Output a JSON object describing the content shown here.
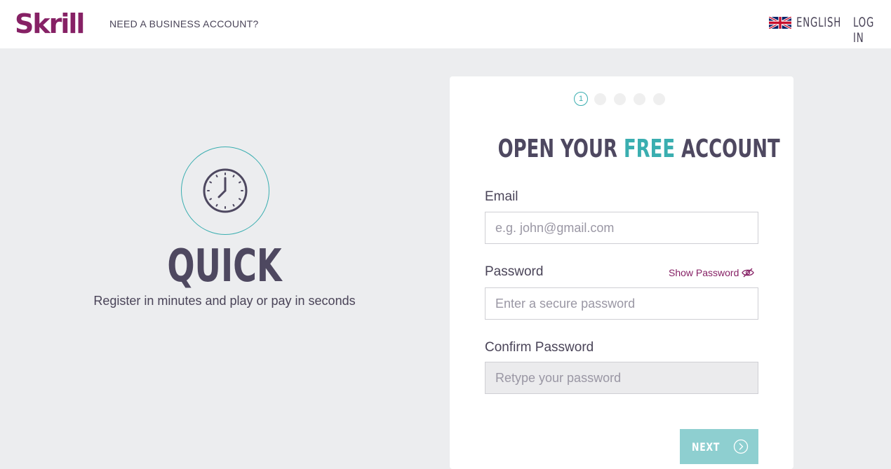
{
  "header": {
    "logo": "Skrill",
    "business_link": "NEED A BUSINESS ACCOUNT?",
    "language": "ENGLISH",
    "login": "LOG IN"
  },
  "promo": {
    "icon": "clock-icon",
    "title": "QUICK",
    "subtitle": "Register in minutes and play or pay in seconds"
  },
  "form": {
    "steps": [
      "1",
      "",
      "",
      "",
      ""
    ],
    "current_step": "1",
    "title_part1": "OPEN YOUR ",
    "title_highlight": "FREE",
    "title_part2": " ACCOUNT",
    "email_label": "Email",
    "email_placeholder": "e.g. john@gmail.com",
    "password_label": "Password",
    "show_password": "Show Password",
    "password_placeholder": "Enter a secure password",
    "confirm_label": "Confirm Password",
    "confirm_placeholder": "Retype your password",
    "next_label": "NEXT"
  },
  "colors": {
    "brand": "#862165",
    "accent": "#3aaeb0",
    "button": "#8ecfd0",
    "background": "#ecedef"
  }
}
